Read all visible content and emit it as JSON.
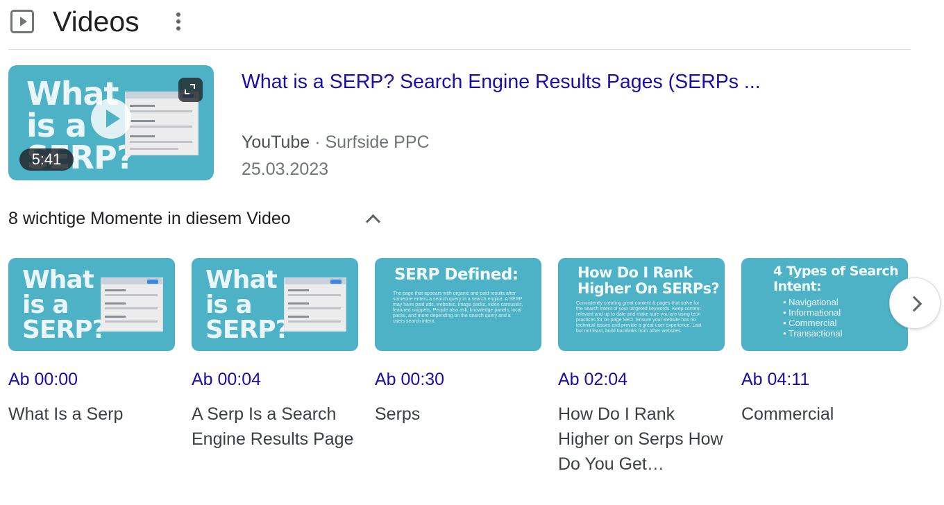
{
  "header": {
    "title": "Videos",
    "icon": "video-section-icon",
    "menu_icon": "more-vert-icon"
  },
  "video": {
    "title": "What is a SERP? Search Engine Results Pages (SERPs ...",
    "source": "YouTube",
    "separator": "·",
    "channel": "Surfside PPC",
    "date": "25.03.2023",
    "duration": "5:41",
    "thumbnail_text": [
      "What",
      "is a",
      "SERP?"
    ]
  },
  "moments": {
    "label": "8 wichtige Momente in diesem Video",
    "items": [
      {
        "timestamp": "Ab 00:00",
        "label": "What Is a Serp",
        "thumb_lines": [
          "What",
          "is a",
          "SERP?"
        ]
      },
      {
        "timestamp": "Ab 00:04",
        "label": "A Serp Is a Search Engine Results Page",
        "thumb_lines": [
          "What",
          "is a",
          "SERP?"
        ]
      },
      {
        "timestamp": "Ab 00:30",
        "label": "Serps",
        "thumb_title": "SERP Defined:",
        "thumb_body": "The page that appears with organic and paid results after someone enters a search query in a search engine. A SERP may have paid ads, websites, image packs, video carousels, featured snippets, People also ask, knowledge panels, local packs, and more depending on the search query and a users search intent."
      },
      {
        "timestamp": "Ab 02:04",
        "label": "How Do I Rank Higher on Serps How Do You Get…",
        "thumb_title": [
          "How Do I Rank",
          "Higher On SERPs?"
        ],
        "thumb_body": "Consistently creating great content & pages that solve for the search intent of your targeted keywords. Keep content relevant and up to date and make sure you are using tech practices for on page SEO. Ensure your website has no technical issues and provide a great user experience. Last but not least, build backlinks from other websites."
      },
      {
        "timestamp": "Ab 04:11",
        "label": "Commercial",
        "thumb_title": [
          "4 Types of Search",
          "Intent:"
        ],
        "thumb_bullets": [
          "• Navigational",
          "• Informational",
          "• Commercial",
          "• Transactional"
        ]
      }
    ]
  },
  "colors": {
    "link": "#1a0dab",
    "thumbnail_bg": "#4eb2c6",
    "text_primary": "#202124",
    "text_secondary": "#70757a"
  }
}
